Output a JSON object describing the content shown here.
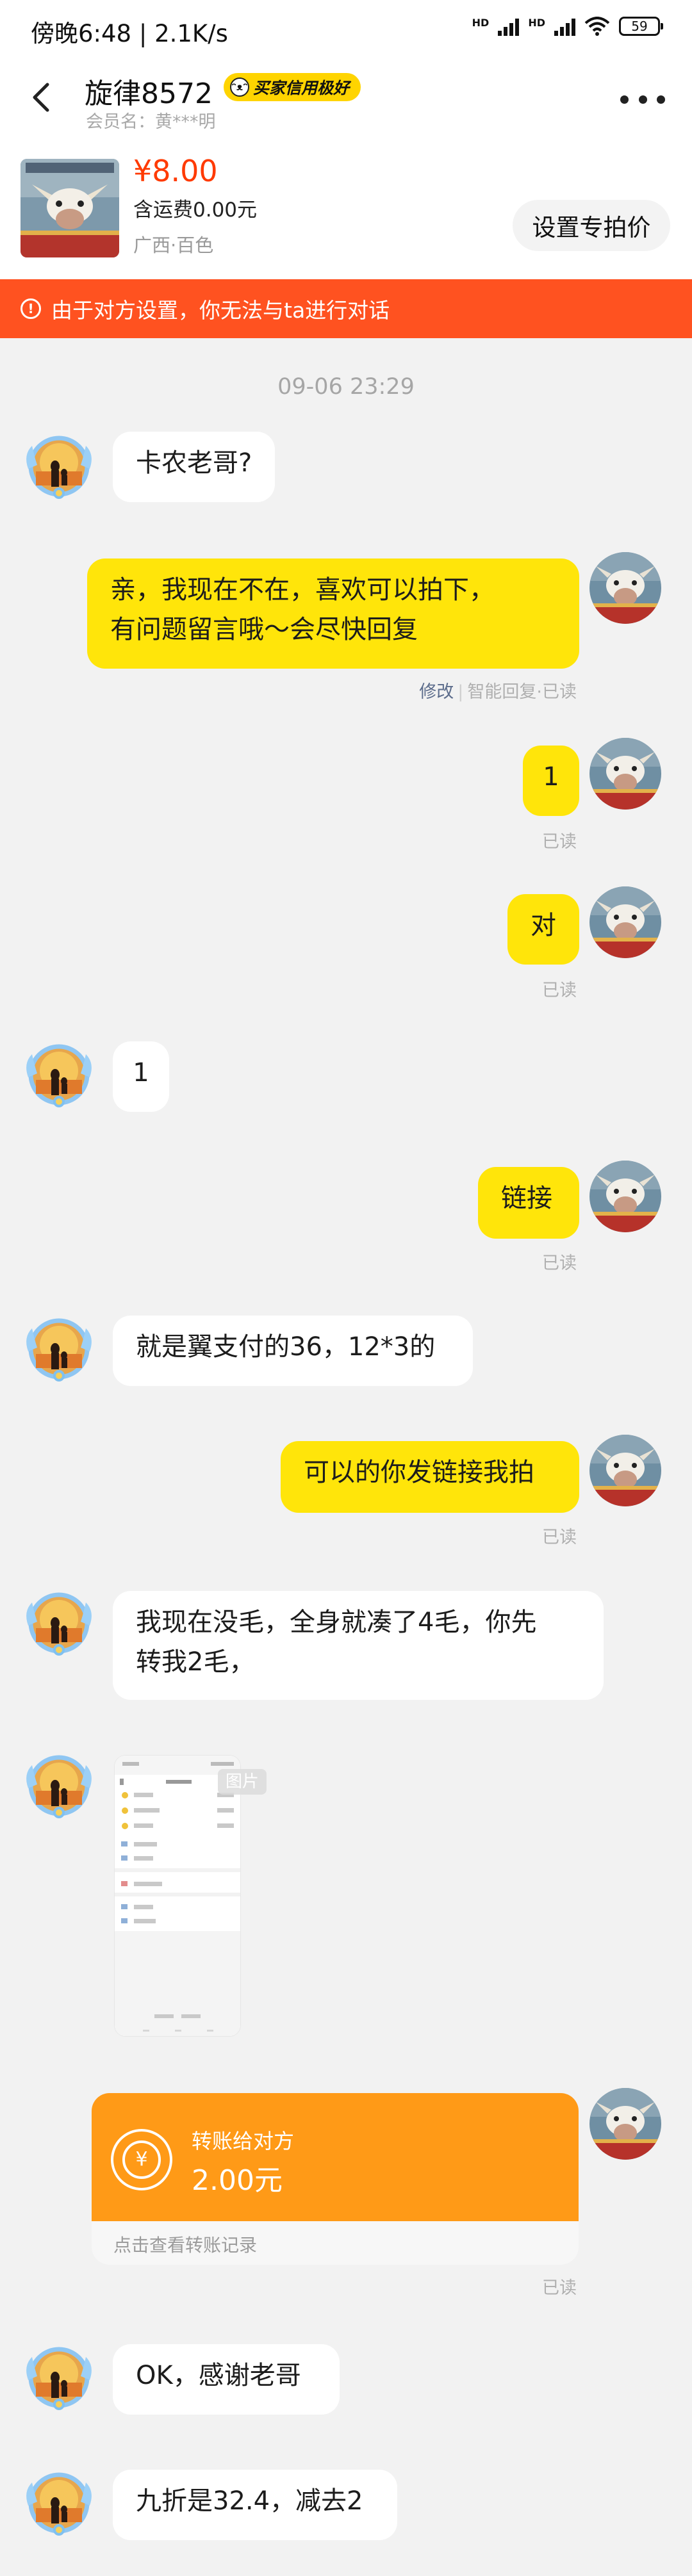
{
  "status_bar": {
    "time": "傍晚6:48 | 2.1K/s",
    "battery": "59",
    "hd1": "HD",
    "hd2": "HD"
  },
  "header": {
    "title": "旋律8572",
    "badge": "买家信用极好",
    "member_label": "会员名：黄***明"
  },
  "product": {
    "price": "¥8.00",
    "shipping": "含运费0.00元",
    "location": "广西·百色",
    "set_price_button": "设置专拍价"
  },
  "warning": {
    "text": "由于对方设置，你无法与ta进行对话"
  },
  "chat": {
    "date": "09-06 23:29",
    "m1": "卡农老哥?",
    "m2_line1": "亲，我现在不在，喜欢可以拍下，",
    "m2_line2": "有问题留言哦～会尽快回复",
    "m2_edit": "修改",
    "m2_status": "智能回复·已读",
    "m3": "1",
    "read": "已读",
    "m4": "对",
    "m5": "1",
    "m6": "链接",
    "m7": "就是翼支付的36，12*3的",
    "m8": "可以的你发链接我拍",
    "m9_line1": "我现在没毛，全身就凑了4毛，你先",
    "m9_line2": "转我2毛，",
    "image_tag": "图片",
    "transfer_title": "转账给对方",
    "transfer_amount": "2.00元",
    "transfer_link": "点击查看转账记录",
    "m11": "OK，感谢老哥",
    "m12": "九折是32.4，减去2"
  },
  "colors": {
    "accent_yellow": "#ffe50a",
    "warning_orange": "#ff5220",
    "price_red": "#ff3a00",
    "transfer_orange": "#ff9a17"
  },
  "icons": [
    "back-arrow-icon",
    "more-icon",
    "warning-icon",
    "yuan-coin-icon",
    "wifi-icon",
    "signal-icon",
    "battery-icon"
  ]
}
